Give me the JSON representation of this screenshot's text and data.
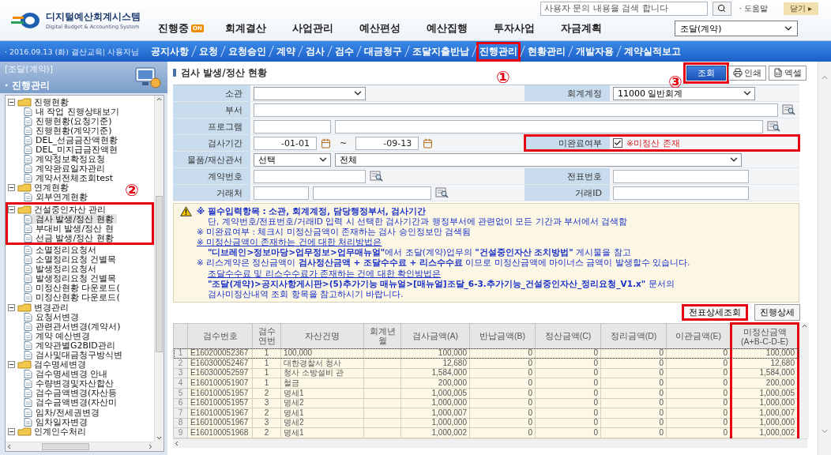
{
  "header": {
    "logo_title": "디지털예산회계시스템",
    "logo_subtitle": "Digital Budget & Accounting System",
    "search_placeholder": "사용자 문의 내용을 검색 합니다",
    "help": "· 도움말",
    "close": "닫기 ▸"
  },
  "main_tabs": [
    {
      "label": "진행중",
      "badge": "ON"
    },
    {
      "label": "회계결산"
    },
    {
      "label": "사업관리"
    },
    {
      "label": "예산편성"
    },
    {
      "label": "예산집행"
    },
    {
      "label": "투자사업"
    },
    {
      "label": "자금계획"
    }
  ],
  "system_select": "조달(계약)",
  "nav": {
    "user_info": "· 2016.09.13 (화) 결산교육| 사용자님",
    "items": [
      {
        "label": "공지사항",
        "highlighted": false
      },
      {
        "label": "요청",
        "highlighted": false
      },
      {
        "label": "요청승인",
        "highlighted": false
      },
      {
        "label": "계약",
        "highlighted": false
      },
      {
        "label": "검사",
        "highlighted": false
      },
      {
        "label": "검수",
        "highlighted": false
      },
      {
        "label": "대금청구",
        "highlighted": false
      },
      {
        "label": "조달지출반납",
        "highlighted": false
      },
      {
        "label": "진행관리",
        "highlighted": true
      },
      {
        "label": "현황관리",
        "highlighted": false
      },
      {
        "label": "개발자용",
        "highlighted": false
      },
      {
        "label": "계약실적보고",
        "highlighted": false
      }
    ]
  },
  "sidebar": {
    "system": "[조달(계약)]",
    "section": "· 진행관리",
    "tree": [
      {
        "label": "진행현황",
        "expanded": true,
        "highlighted": false,
        "children": [
          {
            "label": "내 작업 진행상태보기",
            "selected": false,
            "highlighted": false
          },
          {
            "label": "진행현황(요청기준)",
            "selected": false,
            "highlighted": false
          },
          {
            "label": "진행현황(계약기준)",
            "selected": false,
            "highlighted": false
          },
          {
            "label": "DEL_선금금잔액현황",
            "selected": false,
            "highlighted": false
          },
          {
            "label": "DEL_미지급금잔액현",
            "selected": false,
            "highlighted": false
          },
          {
            "label": "계약정보확정요청",
            "selected": false,
            "highlighted": false
          },
          {
            "label": "계약완료일자관리",
            "selected": false,
            "highlighted": false
          },
          {
            "label": "계약서전체조회test",
            "selected": false,
            "highlighted": false
          }
        ]
      },
      {
        "label": "연계현황",
        "expanded": true,
        "highlighted": false,
        "children": [
          {
            "label": "외부연계현황",
            "selected": false,
            "highlighted": false
          }
        ]
      },
      {
        "label": "건설중인자산 관리",
        "expanded": true,
        "highlighted": true,
        "children": [
          {
            "label": "검사 발생/정산 현황",
            "selected": true,
            "highlighted": true
          },
          {
            "label": "부대비 발생/정산 현",
            "selected": false,
            "highlighted": true
          },
          {
            "label": "선금 발생/정산 현황",
            "selected": false,
            "highlighted": true
          },
          {
            "label": "소멸정리요청서",
            "selected": false,
            "highlighted": false
          },
          {
            "label": "소멸정리요청 건별목",
            "selected": false,
            "highlighted": false
          },
          {
            "label": "발생정리요청서",
            "selected": false,
            "highlighted": false
          },
          {
            "label": "발생정리요청 건별목",
            "selected": false,
            "highlighted": false
          },
          {
            "label": "미정산현황 다운로드(",
            "selected": false,
            "highlighted": false
          },
          {
            "label": "미정산현황 다운로드(",
            "selected": false,
            "highlighted": false
          }
        ]
      },
      {
        "label": "변경관리",
        "expanded": true,
        "highlighted": false,
        "children": [
          {
            "label": "요청서변경",
            "selected": false,
            "highlighted": false
          },
          {
            "label": "관련관서변경(계약서)",
            "selected": false,
            "highlighted": false
          },
          {
            "label": "계약 예산변경",
            "selected": false,
            "highlighted": false
          },
          {
            "label": "계약관별G2BID관리",
            "selected": false,
            "highlighted": false
          },
          {
            "label": "검사및대금청구방식변",
            "selected": false,
            "highlighted": false
          }
        ]
      },
      {
        "label": "검수명세변경",
        "expanded": true,
        "highlighted": false,
        "children": [
          {
            "label": "검수명세변경 안내",
            "selected": false,
            "highlighted": false
          },
          {
            "label": "수량변경및자산합산",
            "selected": false,
            "highlighted": false
          },
          {
            "label": "검수금액변경(자산등",
            "selected": false,
            "highlighted": false
          },
          {
            "label": "검수금액변경(자산미",
            "selected": false,
            "highlighted": false
          },
          {
            "label": "임차/전세권변경",
            "selected": false,
            "highlighted": false
          },
          {
            "label": "임차일자변경",
            "selected": false,
            "highlighted": false
          }
        ]
      },
      {
        "label": "인계인수처리",
        "expanded": true,
        "highlighted": false
      }
    ]
  },
  "page": {
    "title": "검사 발생/정산 현황",
    "buttons": [
      {
        "label": "조회",
        "kind": "primary",
        "highlighted": true
      },
      {
        "label": "인쇄",
        "kind": "print",
        "highlighted": false
      },
      {
        "label": "엑셀",
        "kind": "excel",
        "highlighted": false
      }
    ]
  },
  "form": {
    "jurisdiction": {
      "label": "소관"
    },
    "account": {
      "label": "회계계정",
      "value": "11000 일반회계"
    },
    "department": {
      "label": "부서"
    },
    "program": {
      "label": "프로그램"
    },
    "period": {
      "label": "검사기간",
      "from": "-01-01",
      "separator": "~",
      "to": "-09-13"
    },
    "incomplete": {
      "label": "미완료여부",
      "checked": true,
      "note": "※미정산 존재",
      "highlighted": true
    },
    "office": {
      "label": "물품/재산관서",
      "value": "선택",
      "value_2": "전체"
    },
    "contract_no": {
      "label": "계약번호"
    },
    "voucher_no": {
      "label": "전표번호"
    },
    "vendor": {
      "label": "거래처"
    },
    "vendor_id": {
      "label": "거래ID"
    }
  },
  "notice": {
    "lines": [
      {
        "kind": "item",
        "bold": true,
        "underlined": false,
        "text": "※ 필수입력항목 : 소관, 회계계정, 담당행정부서, 검사기간"
      },
      {
        "kind": "continuation",
        "bold": false,
        "underlined": false,
        "text": "단, 계약번호/전표번호/거래ID 입력 시 선택한 검사기간과 행정부서에 관련없이 모든 기간과 부서에서 검색함"
      },
      {
        "kind": "item",
        "bold": false,
        "underlined": false,
        "text": "※ 미완료여부 : 체크시 미정산금액이 존재하는 검사 승인정보만 검색됨"
      },
      {
        "kind": "item",
        "bold": false,
        "underlined": true,
        "text": "※ 미정산금액이 존재하는 건에 대한 처리방법은"
      },
      {
        "kind": "continuation",
        "bold": false,
        "underlined": false,
        "text": "**\"디브레인>정보마당>업무정보>업무매뉴얼\"**에서 조달(계약)업무의 **\"건설중인자산 조치방법\"** 게시물을 참고"
      },
      {
        "kind": "item",
        "bold": false,
        "underlined": false,
        "text": "※ 리스계약은 정산금액이 **검사정산금액 + 조달수수료 + 리스수수료** 이므로 미정산금액에 마이너스 금액이 발생할수 있습니다."
      },
      {
        "kind": "continuation",
        "bold": false,
        "underlined": true,
        "text": "조달수수료 및 리스수수료가 존재하는 건에 대한 확인방법은"
      },
      {
        "kind": "continuation",
        "bold": false,
        "underlined": false,
        "text": "**\"조달(계약)>공지사항게시판>(5)추가기능 매뉴얼>[매뉴얼]조달_6-3.추가기능_건설중인자산_정리요청_V1.x\"** 문서의"
      },
      {
        "kind": "continuation",
        "bold": false,
        "underlined": false,
        "text": "검사미정산내역 조회 항목을 참고하시기 바랍니다."
      }
    ]
  },
  "grid": {
    "actions": [
      {
        "label": "전표상세조회",
        "highlighted": true
      },
      {
        "label": "진행상세",
        "highlighted": false
      }
    ],
    "columns": [
      {
        "label": "검수번호",
        "highlighted": false
      },
      {
        "label": "검수연번",
        "highlighted": false
      },
      {
        "label": "자산건명",
        "highlighted": false
      },
      {
        "label": "회계년월",
        "highlighted": false
      },
      {
        "label": "검사금액(A)",
        "highlighted": false
      },
      {
        "label": "반납금액(B)",
        "highlighted": false
      },
      {
        "label": "정산금액(C)",
        "highlighted": false
      },
      {
        "label": "정리금액(D)",
        "highlighted": false
      },
      {
        "label": "이관금액(E)",
        "highlighted": false
      },
      {
        "label": "미정산금액(A+B-C-D-E)",
        "highlighted": true
      }
    ],
    "rows": [
      {
        "number": "1",
        "selected": true,
        "cells": [
          "E160200052367",
          "1",
          "100,000",
          "",
          "100,000",
          "0",
          "0",
          "0",
          "0",
          "100,000"
        ]
      },
      {
        "number": "2",
        "selected": false,
        "cells": [
          "E160300052467",
          "1",
          "대한경찰서 청사",
          "",
          "12,680",
          "0",
          "0",
          "0",
          "0",
          "12,680"
        ]
      },
      {
        "number": "3",
        "selected": false,
        "cells": [
          "E160300052597",
          "1",
          "청사 소방설비 관",
          "",
          "1,584,000",
          "0",
          "0",
          "0",
          "0",
          "1,584,000"
        ]
      },
      {
        "number": "4",
        "selected": false,
        "cells": [
          "E160100051907",
          "1",
          "철금",
          "",
          "200,000",
          "0",
          "0",
          "0",
          "0",
          "200,000"
        ]
      },
      {
        "number": "5",
        "selected": false,
        "cells": [
          "E160100051957",
          "2",
          "명세1",
          "",
          "1,000,005",
          "0",
          "0",
          "0",
          "0",
          "1,000,005"
        ]
      },
      {
        "number": "6",
        "selected": false,
        "cells": [
          "E160100051957",
          "3",
          "명세2",
          "",
          "1,000,000",
          "0",
          "0",
          "0",
          "0",
          "1,000,000"
        ]
      },
      {
        "number": "7",
        "selected": false,
        "cells": [
          "E160100051967",
          "2",
          "명세1",
          "",
          "1,000,007",
          "0",
          "0",
          "0",
          "0",
          "1,000,007"
        ]
      },
      {
        "number": "8",
        "selected": false,
        "cells": [
          "E160100051967",
          "3",
          "명세2",
          "",
          "1,000,000",
          "0",
          "0",
          "0",
          "0",
          "1,000,000"
        ]
      },
      {
        "number": "9",
        "selected": false,
        "cells": [
          "E160100051968",
          "2",
          "명세1",
          "",
          "1,000,002",
          "0",
          "0",
          "0",
          "0",
          "1,000,002"
        ]
      }
    ]
  },
  "annotations": [
    {
      "label": "①"
    },
    {
      "label": "②"
    },
    {
      "label": "③"
    }
  ]
}
